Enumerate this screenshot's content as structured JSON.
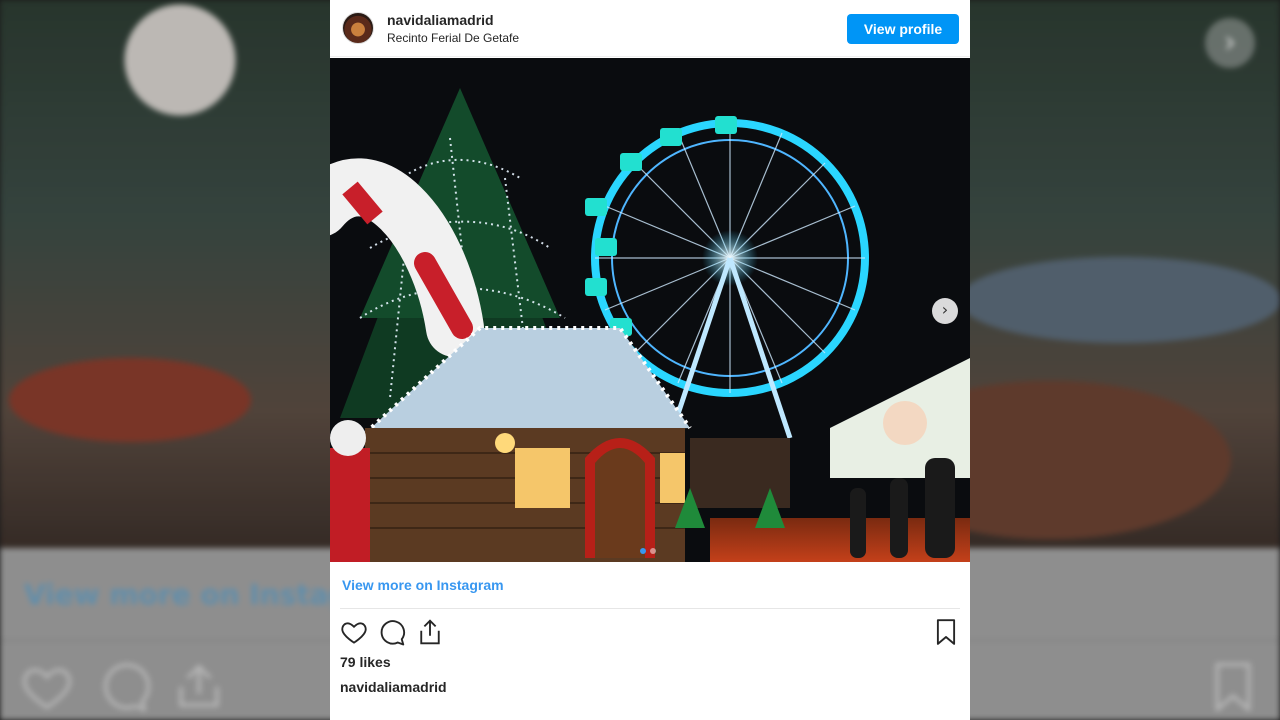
{
  "post": {
    "username": "navidaliamadrid",
    "location": "Recinto Ferial De Getafe",
    "view_profile_label": "View profile",
    "view_more_label": "View more on Instagram",
    "likes": "79 likes",
    "caption_username": "navidaliamadrid",
    "carousel": {
      "total": 2,
      "current": 1
    }
  },
  "background": {
    "view_more_label": "View more on Instagr"
  },
  "icons": {
    "like": "heart-icon",
    "comment": "comment-icon",
    "share": "share-icon",
    "save": "bookmark-icon",
    "next": "chevron-right-icon"
  },
  "colors": {
    "accent": "#0095f6",
    "link": "#3897f0",
    "text": "#262626"
  }
}
